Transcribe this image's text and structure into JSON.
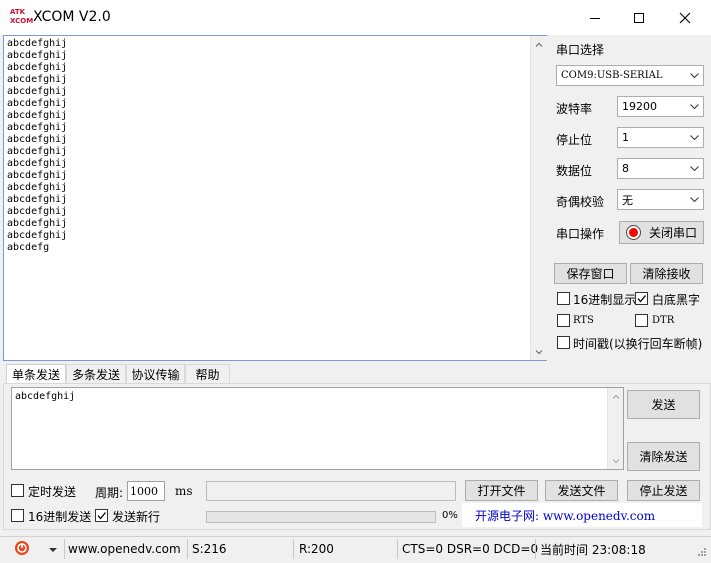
{
  "window": {
    "title": "XCOM V2.0",
    "logo_top": "ATK",
    "logo_bottom": "XCOM"
  },
  "receive": {
    "lines": [
      "abcdefghij",
      "abcdefghij",
      "abcdefghij",
      "abcdefghij",
      "abcdefghij",
      "abcdefghij",
      "abcdefghij",
      "abcdefghij",
      "abcdefghij",
      "abcdefghij",
      "abcdefghij",
      "abcdefghij",
      "abcdefghij",
      "abcdefghij",
      "abcdefghij",
      "abcdefghij",
      "abcdefghij",
      "abcdefg"
    ]
  },
  "serial": {
    "port_select_label": "串口选择",
    "port_value": "COM9:USB-SERIAL",
    "baud_label": "波特率",
    "baud_value": "19200",
    "stop_label": "停止位",
    "stop_value": "1",
    "data_label": "数据位",
    "data_value": "8",
    "parity_label": "奇偶校验",
    "parity_value": "无",
    "op_label": "串口操作",
    "close_port_label": "关闭串口",
    "status_color": "#ff0000"
  },
  "receive_options": {
    "save_window_label": "保存窗口",
    "clear_receive_label": "清除接收",
    "hex_display_label": "16进制显示",
    "hex_display_checked": false,
    "white_black_label": "白底黑字",
    "white_black_checked": true,
    "rts_label": "RTS",
    "rts_checked": false,
    "dtr_label": "DTR",
    "dtr_checked": false,
    "timestamp_label": "时间戳(以换行回车断帧)",
    "timestamp_checked": false
  },
  "tabs": [
    {
      "label": "单条发送",
      "active": true
    },
    {
      "label": "多条发送",
      "active": false
    },
    {
      "label": "协议传输",
      "active": false
    },
    {
      "label": "帮助",
      "active": false
    }
  ],
  "send": {
    "text": "abcdefghij",
    "send_label": "发送",
    "clear_send_label": "清除发送",
    "timed_send_label": "定时发送",
    "timed_send_checked": false,
    "period_label": "周期:",
    "period_value": "1000",
    "period_unit": "ms",
    "open_file_label": "打开文件",
    "send_file_label": "发送文件",
    "stop_send_label": "停止发送",
    "hex_send_label": "16进制发送",
    "hex_send_checked": false,
    "send_newline_label": "发送新行",
    "send_newline_checked": true,
    "progress_text": "0%",
    "progress": 0,
    "promo_text": "开源电子网: www.openedv.com",
    "promo_color": "#0000cc"
  },
  "status": {
    "website": "www.openedv.com",
    "sent": "S:216",
    "received": "R:200",
    "signals": "CTS=0 DSR=0 DCD=0",
    "time": "当前时间 23:08:18"
  }
}
